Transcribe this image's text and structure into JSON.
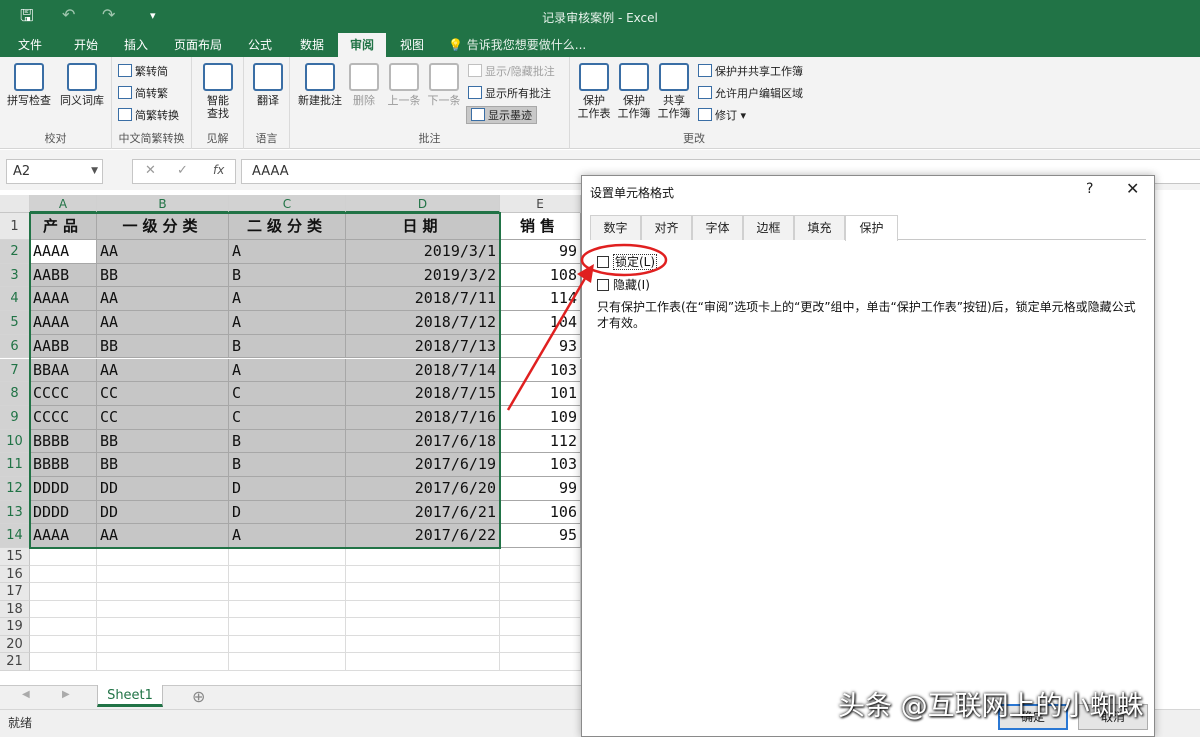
{
  "app": {
    "window_title": "记录审核案例 - Excel"
  },
  "tabs": [
    "文件",
    "开始",
    "插入",
    "页面布局",
    "公式",
    "数据",
    "审阅",
    "视图"
  ],
  "active_tab": "审阅",
  "tell_me": "告诉我您想要做什么...",
  "ribbon": {
    "proofing": {
      "spell": "拼写检查",
      "thesaurus": "同义词库",
      "group": "校对"
    },
    "chinese": {
      "to_simplified": "繁转简",
      "to_traditional": "简转繁",
      "convert": "简繁转换",
      "group": "中文简繁转换"
    },
    "insights": {
      "smart_lookup_line1": "智能",
      "smart_lookup_line2": "查找",
      "group": "见解"
    },
    "language": {
      "translate": "翻译",
      "group": "语言"
    },
    "comments": {
      "new": "新建批注",
      "delete": "删除",
      "prev": "上一条",
      "next": "下一条",
      "show_hide": "显示/隐藏批注",
      "show_all": "显示所有批注",
      "show_ink": "显示墨迹",
      "group": "批注"
    },
    "changes": {
      "protect_sheet_1": "保护",
      "protect_sheet_2": "工作表",
      "protect_wb_1": "保护",
      "protect_wb_2": "工作簿",
      "share_wb_1": "共享",
      "share_wb_2": "工作簿",
      "protect_share": "保护并共享工作簿",
      "allow_edit": "允许用户编辑区域",
      "track": "修订 ▾",
      "group": "更改"
    }
  },
  "formula_bar": {
    "name_box": "A2",
    "formula": "AAAA",
    "fx": "fx"
  },
  "sheet": {
    "columns": [
      "A",
      "B",
      "C",
      "D",
      "E"
    ],
    "headers": [
      "产品",
      "一级分类",
      "二级分类",
      "日期",
      "销售"
    ],
    "rows": [
      [
        "AAAA",
        "AA",
        "A",
        "2019/3/1",
        "99"
      ],
      [
        "AABB",
        "BB",
        "B",
        "2019/3/2",
        "108"
      ],
      [
        "AAAA",
        "AA",
        "A",
        "2018/7/11",
        "114"
      ],
      [
        "AAAA",
        "AA",
        "A",
        "2018/7/12",
        "104"
      ],
      [
        "AABB",
        "BB",
        "B",
        "2018/7/13",
        "93"
      ],
      [
        "BBAA",
        "AA",
        "A",
        "2018/7/14",
        "103"
      ],
      [
        "CCCC",
        "CC",
        "C",
        "2018/7/15",
        "101"
      ],
      [
        "CCCC",
        "CC",
        "C",
        "2018/7/16",
        "109"
      ],
      [
        "BBBB",
        "BB",
        "B",
        "2017/6/18",
        "112"
      ],
      [
        "BBBB",
        "BB",
        "B",
        "2017/6/19",
        "103"
      ],
      [
        "DDDD",
        "DD",
        "D",
        "2017/6/20",
        "99"
      ],
      [
        "DDDD",
        "DD",
        "D",
        "2017/6/21",
        "106"
      ],
      [
        "AAAA",
        "AA",
        "A",
        "2017/6/22",
        "95"
      ]
    ],
    "row_numbers": [
      "1",
      "2",
      "3",
      "4",
      "5",
      "6",
      "7",
      "8",
      "9",
      "10",
      "11",
      "12",
      "13",
      "14",
      "15",
      "16",
      "17",
      "18",
      "19",
      "20",
      "21"
    ],
    "sheet_tab": "Sheet1",
    "add_sheet": "⊕"
  },
  "status": {
    "ready": "就绪"
  },
  "dialog": {
    "title": "设置单元格格式",
    "help": "?",
    "close": "✕",
    "tabs": [
      "数字",
      "对齐",
      "字体",
      "边框",
      "填充",
      "保护"
    ],
    "active_tab": "保护",
    "locked_label": "锁定(L)",
    "locked_checked": false,
    "hidden_label": "隐藏(I)",
    "hidden_checked": false,
    "description": "只有保护工作表(在“审阅”选项卡上的“更改”组中，单击“保护工作表”按钮)后，锁定单元格或隐藏公式才有效。",
    "ok": "确定",
    "cancel": "取消"
  },
  "watermark": "头条 @互联网上的小蜘蛛",
  "colors": {
    "excel_green": "#217346",
    "selection_fill": "#c6c6c6",
    "annotation_red": "#e02020"
  }
}
